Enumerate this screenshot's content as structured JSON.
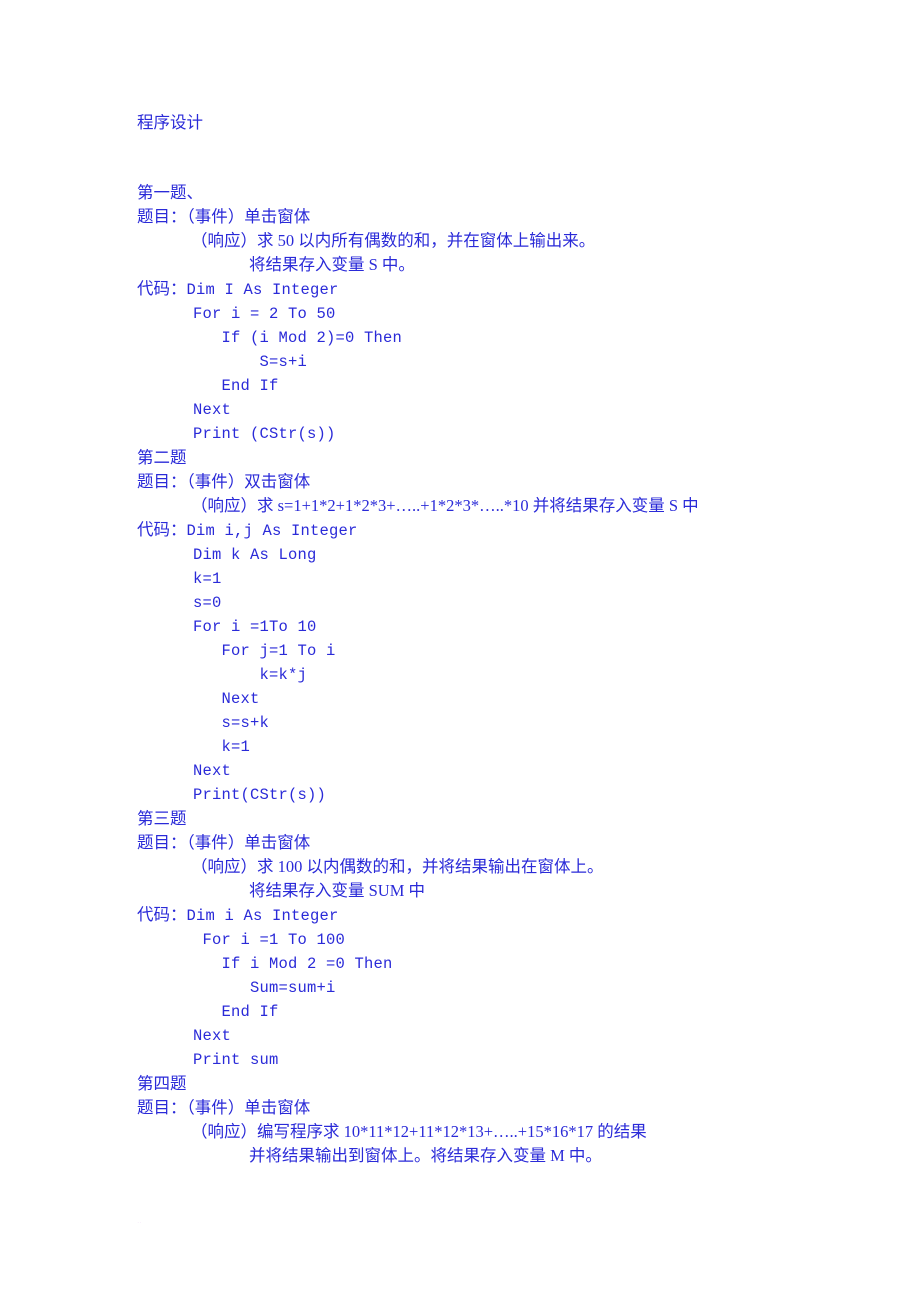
{
  "document": {
    "title": "程序设计",
    "text_color": "#2a2ad8",
    "background_color": "#ffffff"
  },
  "sections": [
    {
      "heading": "第一题、",
      "problem_label": "题目：",
      "event_line": "（事件）单击窗体",
      "response_lines": [
        "（响应）求 50 以内所有偶数的和，并在窗体上输出来。",
        "将结果存入变量 S 中。"
      ],
      "code_label": "代码：",
      "code_first": "Dim I As Integer",
      "code_rest": [
        "For i = 2 To 50",
        "   If (i Mod 2)=0 Then",
        "       S=s+i",
        "   End If",
        "Next",
        "Print (CStr(s))"
      ]
    },
    {
      "heading": "第二题",
      "problem_label": "题目：",
      "event_line": "（事件）双击窗体",
      "response_lines": [
        "（响应）求 s=1+1*2+1*2*3+…..+1*2*3*…..*10 并将结果存入变量 S 中"
      ],
      "code_label": "代码：",
      "code_first": "Dim i,j As Integer",
      "code_rest": [
        "Dim k As Long",
        "k=1",
        "s=0",
        "For i =1To 10",
        "   For j=1 To i",
        "       k=k*j",
        "   Next",
        "   s=s+k",
        "   k=1",
        "Next",
        "Print(CStr(s))"
      ]
    },
    {
      "heading": "第三题",
      "problem_label": "题目：",
      "event_line": "（事件）单击窗体",
      "response_lines": [
        "（响应）求 100 以内偶数的和，并将结果输出在窗体上。",
        "将结果存入变量 SUM 中"
      ],
      "code_label": "代码：",
      "code_first": "Dim i As Integer",
      "code_rest": [
        " For i =1 To 100",
        "   If i Mod 2 =0 Then",
        "      Sum=sum+i",
        "   End If",
        "Next",
        "Print sum"
      ]
    },
    {
      "heading": "第四题",
      "problem_label": "题目：",
      "event_line": "（事件）单击窗体",
      "response_lines": [
        "（响应）编写程序求 10*11*12+11*12*13+…..+15*16*17 的结果",
        "并将结果输出到窗体上。将结果存入变量 M 中。"
      ],
      "code_label": "",
      "code_first": "",
      "code_rest": []
    }
  ]
}
